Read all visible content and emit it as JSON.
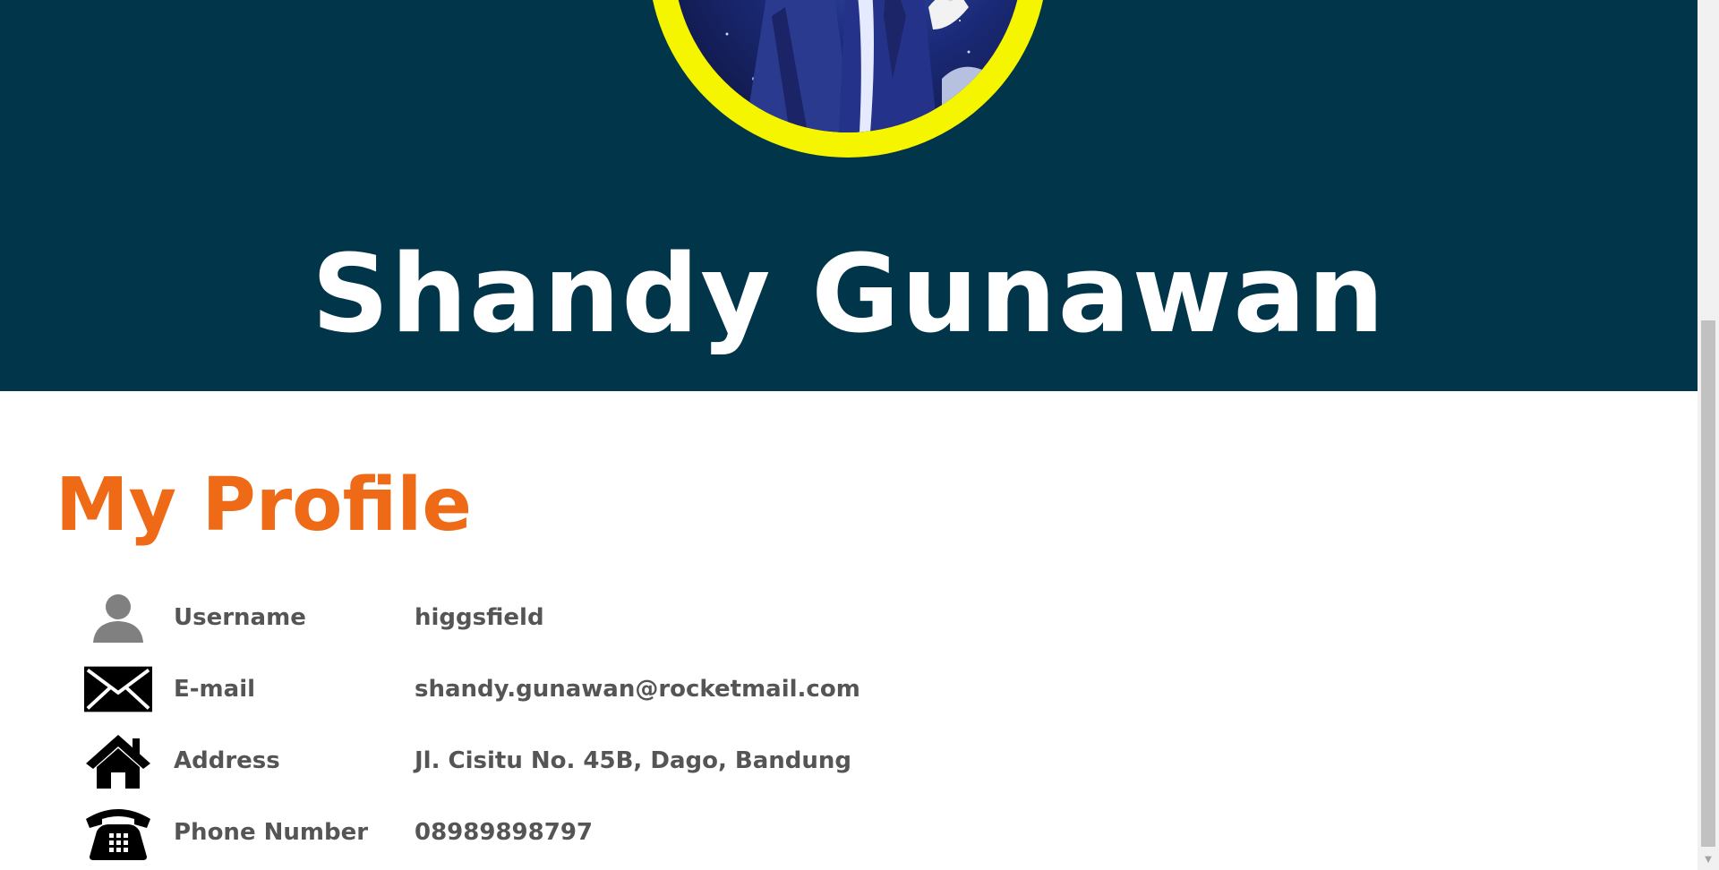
{
  "hero": {
    "name": "Shandy Gunawan",
    "background_color": "#00354a",
    "avatar_ring_color": "#f5f500"
  },
  "profile": {
    "title": "My Profile",
    "title_color": "#ef6a16",
    "rows": [
      {
        "icon": "user-icon",
        "label": "Username",
        "value": "higgsfield"
      },
      {
        "icon": "envelope-icon",
        "label": "E-mail",
        "value": "shandy.gunawan@rocketmail.com"
      },
      {
        "icon": "home-icon",
        "label": "Address",
        "value": "Jl. Cisitu No. 45B, Dago, Bandung"
      },
      {
        "icon": "telephone-icon",
        "label": "Phone Number",
        "value": "08989898797"
      }
    ]
  },
  "scrollbar": {
    "arrow_down": "▼"
  }
}
